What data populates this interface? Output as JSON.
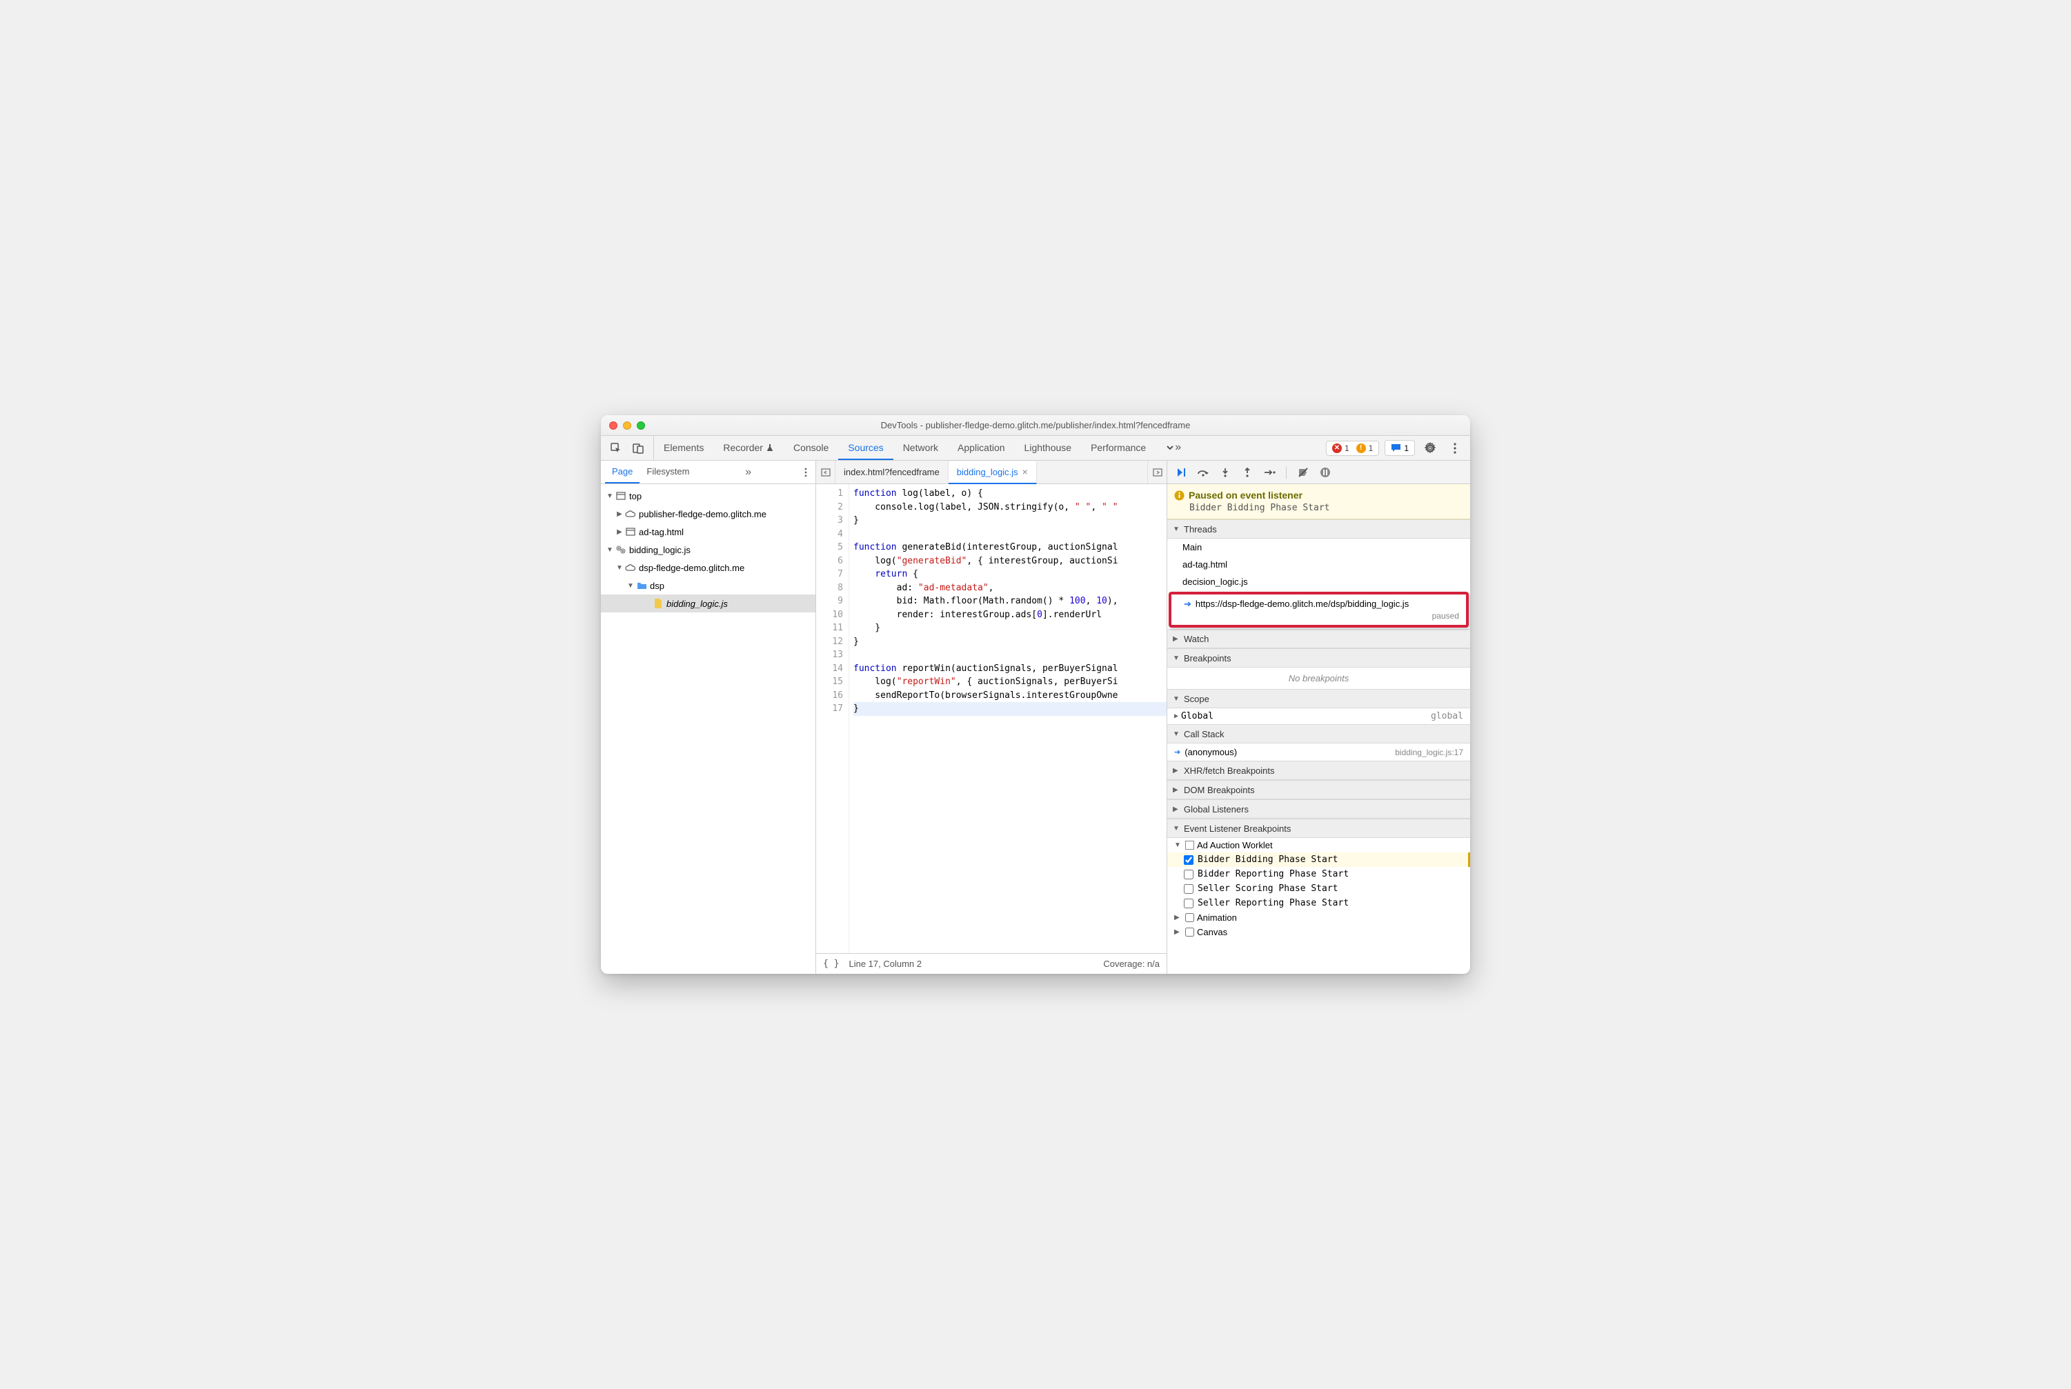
{
  "window_title": "DevTools - publisher-fledge-demo.glitch.me/publisher/index.html?fencedframe",
  "main_tabs": [
    "Elements",
    "Recorder",
    "Console",
    "Sources",
    "Network",
    "Application",
    "Lighthouse",
    "Performance"
  ],
  "main_tab_active": "Sources",
  "errors_count": "1",
  "warnings_count": "1",
  "messages_count": "1",
  "left_tabs": [
    "Page",
    "Filesystem"
  ],
  "left_tab_active": "Page",
  "file_tree": {
    "top": "top",
    "pub_domain": "publisher-fledge-demo.glitch.me",
    "ad_tag": "ad-tag.html",
    "bidding_worklet": "bidding_logic.js",
    "dsp_domain": "dsp-fledge-demo.glitch.me",
    "dsp_folder": "dsp",
    "bidding_file": "bidding_logic.js"
  },
  "open_tabs": [
    {
      "label": "index.html?fencedframe",
      "active": false
    },
    {
      "label": "bidding_logic.js",
      "active": true
    }
  ],
  "code_lines": [
    {
      "n": "1",
      "html": "<span class='kw'>function</span> <span class='fn'>log</span>(label, o) {"
    },
    {
      "n": "2",
      "html": "    console.log(label, JSON.stringify(o, <span class='str'>\" \"</span>, <span class='str'>\" \"</span>"
    },
    {
      "n": "3",
      "html": "}"
    },
    {
      "n": "4",
      "html": ""
    },
    {
      "n": "5",
      "html": "<span class='kw'>function</span> <span class='fn'>generateBid</span>(interestGroup, auctionSignal"
    },
    {
      "n": "6",
      "html": "    log(<span class='str'>\"generateBid\"</span>, { interestGroup, auctionSi"
    },
    {
      "n": "7",
      "html": "    <span class='kw'>return</span> {"
    },
    {
      "n": "8",
      "html": "        ad: <span class='str'>\"ad-metadata\"</span>,"
    },
    {
      "n": "9",
      "html": "        bid: Math.floor(Math.random() * <span class='num'>100</span>, <span class='num'>10</span>),"
    },
    {
      "n": "10",
      "html": "        render: interestGroup.ads[<span class='num'>0</span>].renderUrl"
    },
    {
      "n": "11",
      "html": "    }"
    },
    {
      "n": "12",
      "html": "}"
    },
    {
      "n": "13",
      "html": ""
    },
    {
      "n": "14",
      "html": "<span class='kw'>function</span> <span class='fn'>reportWin</span>(auctionSignals, perBuyerSignal"
    },
    {
      "n": "15",
      "html": "    log(<span class='str'>\"reportWin\"</span>, { auctionSignals, perBuyerSi"
    },
    {
      "n": "16",
      "html": "    sendReportTo(browserSignals.interestGroupOwne"
    },
    {
      "n": "17",
      "html": "}",
      "cursor": true
    }
  ],
  "status": {
    "pretty": "{ }",
    "pos": "Line 17, Column 2",
    "coverage": "Coverage: n/a"
  },
  "paused": {
    "title": "Paused on event listener",
    "sub": "Bidder Bidding Phase Start"
  },
  "threads": {
    "header": "Threads",
    "items": [
      "Main",
      "ad-tag.html",
      "decision_logic.js"
    ],
    "highlighted": "https://dsp-fledge-demo.glitch.me/dsp/bidding_logic.js",
    "paused_label": "paused"
  },
  "watch_header": "Watch",
  "breakpoints": {
    "header": "Breakpoints",
    "empty": "No breakpoints"
  },
  "scope": {
    "header": "Scope",
    "global": "Global",
    "global_val": "global"
  },
  "callstack": {
    "header": "Call Stack",
    "frame": "(anonymous)",
    "loc": "bidding_logic.js:17"
  },
  "xhr_header": "XHR/fetch Breakpoints",
  "dom_header": "DOM Breakpoints",
  "gl_header": "Global Listeners",
  "elb": {
    "header": "Event Listener Breakpoints",
    "cat1": "Ad Auction Worklet",
    "items": [
      {
        "label": "Bidder Bidding Phase Start",
        "checked": true,
        "hit": true
      },
      {
        "label": "Bidder Reporting Phase Start",
        "checked": false
      },
      {
        "label": "Seller Scoring Phase Start",
        "checked": false
      },
      {
        "label": "Seller Reporting Phase Start",
        "checked": false
      }
    ],
    "cat2": "Animation",
    "cat3": "Canvas"
  }
}
